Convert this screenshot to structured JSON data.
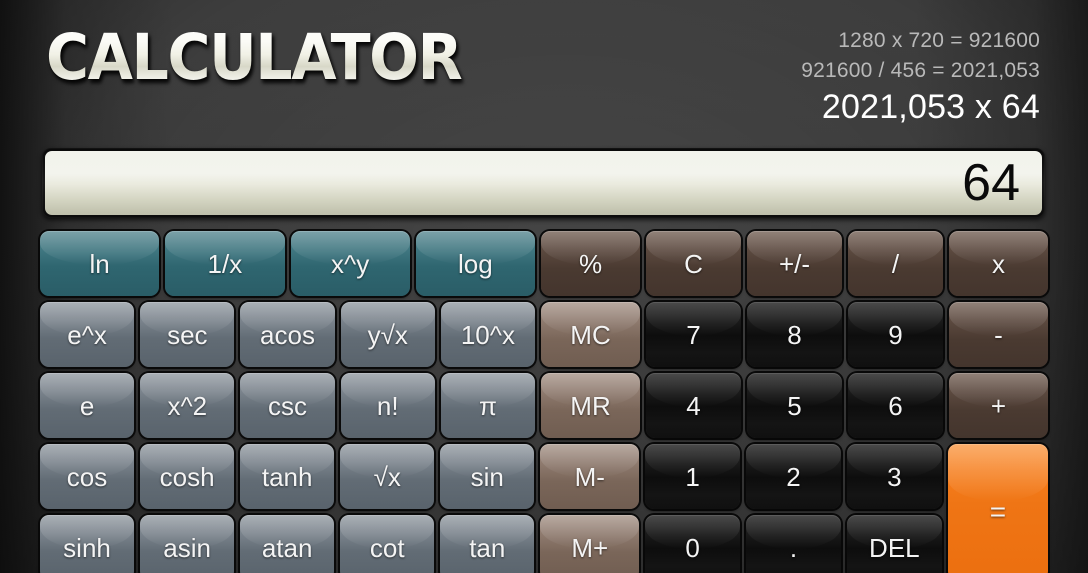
{
  "app": {
    "title": "CALCULATOR"
  },
  "history": {
    "lines": [
      "1280 x 720 = 921600",
      "921600 / 456 = 2021,053"
    ],
    "current": "2021,053 x 64"
  },
  "display": {
    "value": "64"
  },
  "colors": {
    "background": "#3a3a3a",
    "teal": "#3e757f",
    "grey": "#79828b",
    "brown": "#5a483e",
    "tan": "#8e7a6e",
    "dark": "#141414",
    "orange": "#ef7515",
    "display_text": "#0a0a0a"
  },
  "keys": {
    "row1_sci": [
      "ln",
      "1/x",
      "x^y",
      "log"
    ],
    "row1_ops": [
      "%",
      "C",
      "+/-",
      "/",
      "x"
    ],
    "row2_sci": [
      "e^x",
      "sec",
      "acos",
      "y√x",
      "10^x"
    ],
    "row2_mem": "MC",
    "row2_num": [
      "7",
      "8",
      "9"
    ],
    "row2_op": "-",
    "row3_sci": [
      "e",
      "x^2",
      "csc",
      "n!",
      "π"
    ],
    "row3_mem": "MR",
    "row3_num": [
      "4",
      "5",
      "6"
    ],
    "row3_op": "+",
    "row4_sci": [
      "cos",
      "cosh",
      "tanh",
      "√x",
      "sin"
    ],
    "row4_mem": "M-",
    "row4_num": [
      "1",
      "2",
      "3"
    ],
    "row5_sci": [
      "sinh",
      "asin",
      "atan",
      "cot",
      "tan"
    ],
    "row5_mem": "M+",
    "row5_num": [
      "0",
      ".",
      "DEL"
    ],
    "equals": "="
  }
}
